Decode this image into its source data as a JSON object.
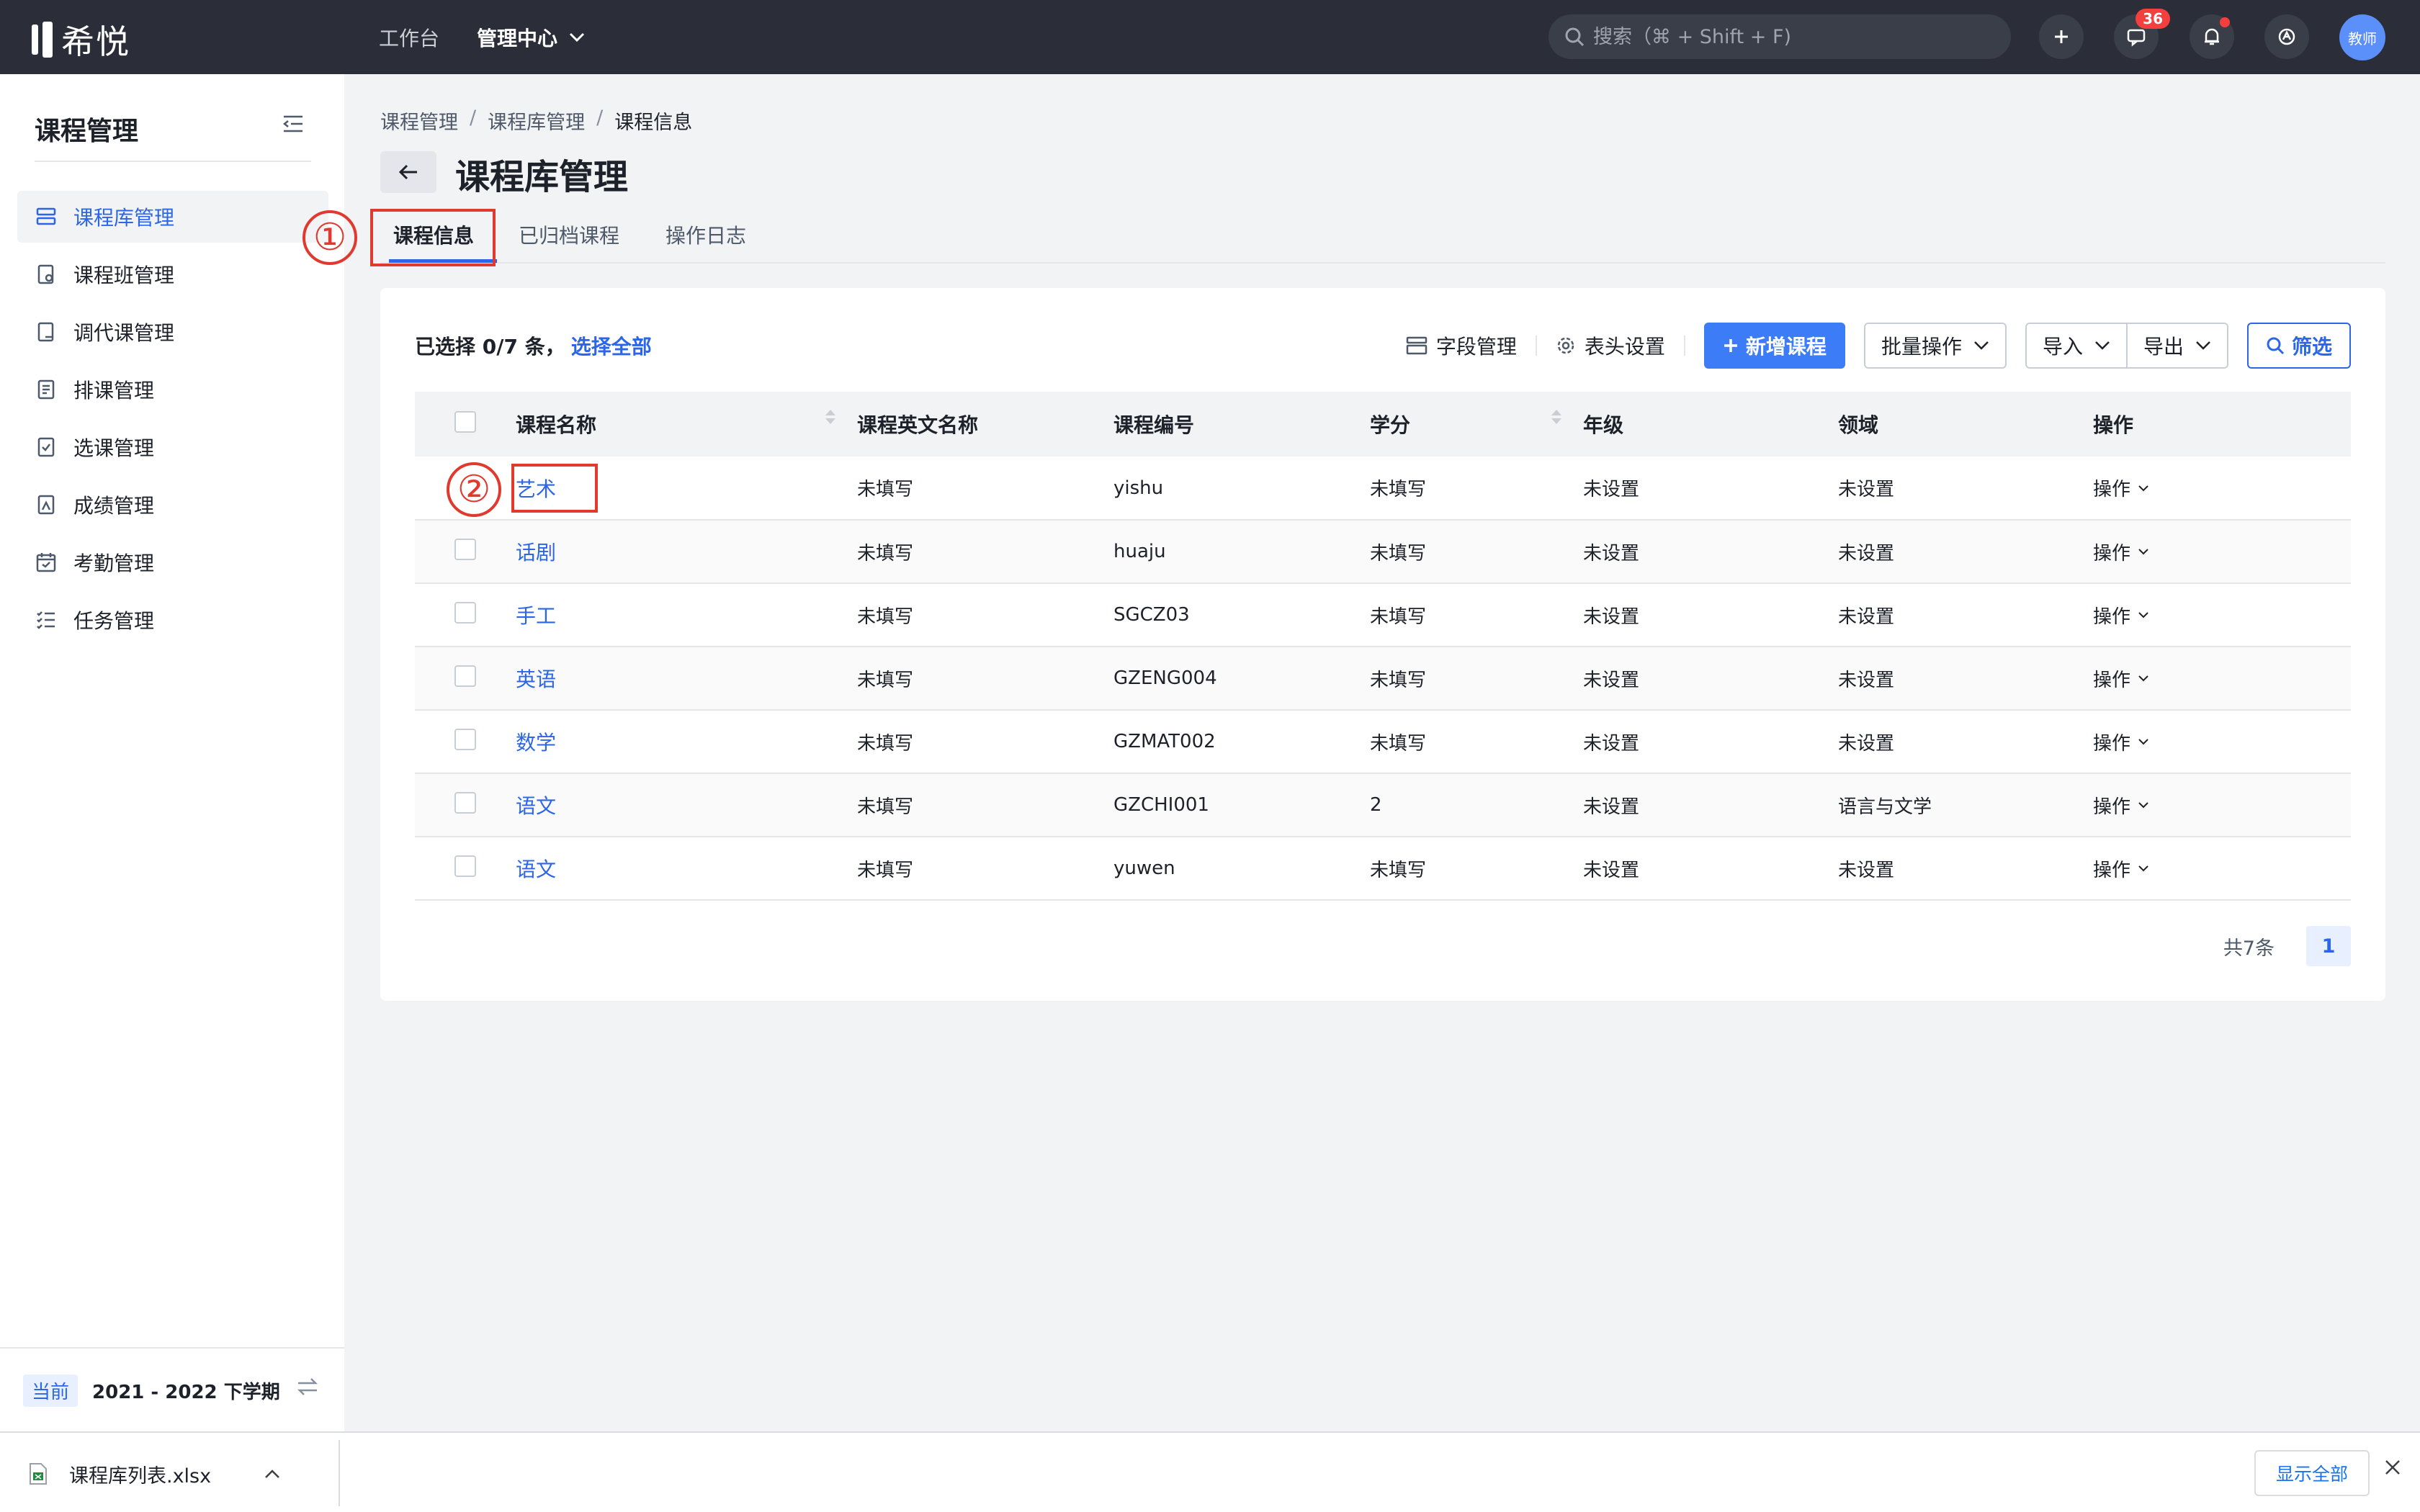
{
  "app": {
    "brand": "希悦",
    "nav": [
      {
        "label": "工作台"
      },
      {
        "label": "管理中心"
      }
    ],
    "search_placeholder": "搜索（⌘ + Shift + F)",
    "message_badge": "36",
    "avatar_label": "教师"
  },
  "sidebar": {
    "title": "课程管理",
    "items": [
      {
        "label": "课程库管理",
        "icon": "list-icon",
        "active": true
      },
      {
        "label": "课程班管理",
        "icon": "class-icon"
      },
      {
        "label": "调代课管理",
        "icon": "swap-icon"
      },
      {
        "label": "排课管理",
        "icon": "schedule-icon"
      },
      {
        "label": "选课管理",
        "icon": "check-icon"
      },
      {
        "label": "成绩管理",
        "icon": "grade-icon"
      },
      {
        "label": "考勤管理",
        "icon": "calendar-icon"
      },
      {
        "label": "任务管理",
        "icon": "tasks-icon"
      }
    ],
    "term_tag": "当前",
    "term": "2021 - 2022 下学期"
  },
  "main": {
    "breadcrumb": [
      "课程管理",
      "课程库管理",
      "课程信息"
    ],
    "page_title": "课程库管理",
    "tabs": [
      {
        "label": "课程信息",
        "active": true
      },
      {
        "label": "已归档课程"
      },
      {
        "label": "操作日志"
      }
    ],
    "annotations": [
      "①",
      "②"
    ],
    "selection": {
      "text": "已选择 0/7 条，",
      "select_all": "选择全部"
    },
    "toolbar": {
      "field_manage": "字段管理",
      "header_settings": "表头设置",
      "add_course": "新增课程",
      "batch_ops": "批量操作",
      "import": "导入",
      "export": "导出",
      "filter": "筛选"
    },
    "table": {
      "columns": [
        "课程名称",
        "课程英文名称",
        "课程编号",
        "学分",
        "年级",
        "领域",
        "操作"
      ],
      "rows": [
        {
          "name": "艺术",
          "en_name": "未填写",
          "code": "yishu",
          "credit": "未填写",
          "grade": "未设置",
          "domain": "未设置",
          "action": "操作"
        },
        {
          "name": "话剧",
          "en_name": "未填写",
          "code": "huaju",
          "credit": "未填写",
          "grade": "未设置",
          "domain": "未设置",
          "action": "操作"
        },
        {
          "name": "手工",
          "en_name": "未填写",
          "code": "SGCZ03",
          "credit": "未填写",
          "grade": "未设置",
          "domain": "未设置",
          "action": "操作"
        },
        {
          "name": "英语",
          "en_name": "未填写",
          "code": "GZENG004",
          "credit": "未填写",
          "grade": "未设置",
          "domain": "未设置",
          "action": "操作"
        },
        {
          "name": "数学",
          "en_name": "未填写",
          "code": "GZMAT002",
          "credit": "未填写",
          "grade": "未设置",
          "domain": "未设置",
          "action": "操作"
        },
        {
          "name": "语文",
          "en_name": "未填写",
          "code": "GZCHI001",
          "credit": "2",
          "grade": "未设置",
          "domain": "语言与文学",
          "action": "操作"
        },
        {
          "name": "语文",
          "en_name": "未填写",
          "code": "yuwen",
          "credit": "未填写",
          "grade": "未设置",
          "domain": "未设置",
          "action": "操作"
        }
      ]
    },
    "pagination": {
      "total": "共7条",
      "current_page": "1"
    }
  },
  "download_bar": {
    "file_name": "课程库列表.xlsx",
    "show_all": "显示全部"
  },
  "colors": {
    "topbar": "#2b2e38",
    "accent": "#2c66e8",
    "primary_button": "#3c7cf6",
    "annotation": "#e03a2f",
    "badge": "#f53f3f"
  }
}
